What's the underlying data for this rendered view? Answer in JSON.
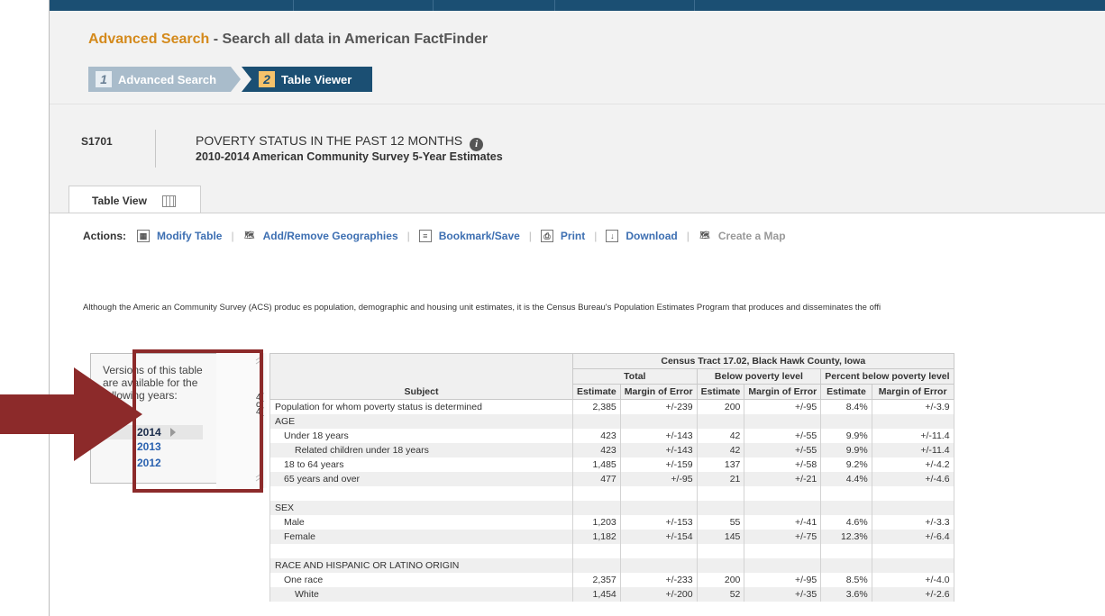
{
  "page": {
    "title_link": "Advanced Search",
    "title_rest": " - Search all data in American FactFinder"
  },
  "steps": [
    {
      "num": "1",
      "label": "Advanced Search"
    },
    {
      "num": "2",
      "label": "Table Viewer"
    }
  ],
  "table_info": {
    "id": "S1701",
    "title": "POVERTY STATUS IN THE PAST 12 MONTHS",
    "subtitle": "2010-2014 American Community Survey 5-Year Estimates"
  },
  "tab": {
    "label": "Table View"
  },
  "actions": {
    "label": "Actions:",
    "items": [
      {
        "label": "Modify Table",
        "icon": "modify-table-icon"
      },
      {
        "label": "Add/Remove Geographies",
        "icon": "geographies-icon"
      },
      {
        "label": "Bookmark/Save",
        "icon": "bookmark-icon"
      },
      {
        "label": "Print",
        "icon": "print-icon"
      },
      {
        "label": "Download",
        "icon": "download-icon"
      },
      {
        "label": "Create a Map",
        "icon": "map-icon",
        "disabled": true
      }
    ]
  },
  "note": "Although the Americ an Community Survey (ACS) produc es population, demographic and housing unit estimates, it is the Census Bureau's Population Estimates Program that produces and disseminates the offi",
  "versions": {
    "text": "Versions of this table are available for the following years:",
    "selected": "2014",
    "others": [
      "2013",
      "2012"
    ],
    "edge_text": [
      "4(",
      "c",
      "4("
    ]
  },
  "table": {
    "geo": "Census Tract 17.02, Black Hawk County, Iowa",
    "groups": [
      "Total",
      "Below poverty level",
      "Percent below poverty level"
    ],
    "subject_header": "Subject",
    "col_headers": [
      "Estimate",
      "Margin of Error",
      "Estimate",
      "Margin of Error",
      "Estimate",
      "Margin of Error"
    ],
    "rows": [
      {
        "label": "Population for whom poverty status is determined",
        "indent": 0,
        "vals": [
          "2,385",
          "+/-239",
          "200",
          "+/-95",
          "8.4%",
          "+/-3.9"
        ]
      },
      {
        "label": "AGE",
        "indent": 0,
        "vals": [
          "",
          "",
          "",
          "",
          "",
          ""
        ]
      },
      {
        "label": "Under 18 years",
        "indent": 1,
        "vals": [
          "423",
          "+/-143",
          "42",
          "+/-55",
          "9.9%",
          "+/-11.4"
        ]
      },
      {
        "label": "Related children under 18 years",
        "indent": 2,
        "vals": [
          "423",
          "+/-143",
          "42",
          "+/-55",
          "9.9%",
          "+/-11.4"
        ]
      },
      {
        "label": "18 to 64 years",
        "indent": 1,
        "vals": [
          "1,485",
          "+/-159",
          "137",
          "+/-58",
          "9.2%",
          "+/-4.2"
        ]
      },
      {
        "label": "65 years and over",
        "indent": 1,
        "vals": [
          "477",
          "+/-95",
          "21",
          "+/-21",
          "4.4%",
          "+/-4.6"
        ]
      },
      {
        "label": "",
        "indent": 0,
        "vals": [
          "",
          "",
          "",
          "",
          "",
          ""
        ]
      },
      {
        "label": "SEX",
        "indent": 0,
        "vals": [
          "",
          "",
          "",
          "",
          "",
          ""
        ]
      },
      {
        "label": "Male",
        "indent": 1,
        "vals": [
          "1,203",
          "+/-153",
          "55",
          "+/-41",
          "4.6%",
          "+/-3.3"
        ]
      },
      {
        "label": "Female",
        "indent": 1,
        "vals": [
          "1,182",
          "+/-154",
          "145",
          "+/-75",
          "12.3%",
          "+/-6.4"
        ]
      },
      {
        "label": "",
        "indent": 0,
        "vals": [
          "",
          "",
          "",
          "",
          "",
          ""
        ]
      },
      {
        "label": "RACE AND HISPANIC OR LATINO ORIGIN",
        "indent": 0,
        "vals": [
          "",
          "",
          "",
          "",
          "",
          ""
        ]
      },
      {
        "label": "One race",
        "indent": 1,
        "vals": [
          "2,357",
          "+/-233",
          "200",
          "+/-95",
          "8.5%",
          "+/-4.0"
        ]
      },
      {
        "label": "White",
        "indent": 2,
        "vals": [
          "1,454",
          "+/-200",
          "52",
          "+/-35",
          "3.6%",
          "+/-2.6"
        ]
      }
    ]
  },
  "colors": {
    "brand_navy": "#1b4f73",
    "title_orange": "#d48a1c",
    "link_blue": "#3d6fb2",
    "annotation_red": "#8c2a2a"
  }
}
